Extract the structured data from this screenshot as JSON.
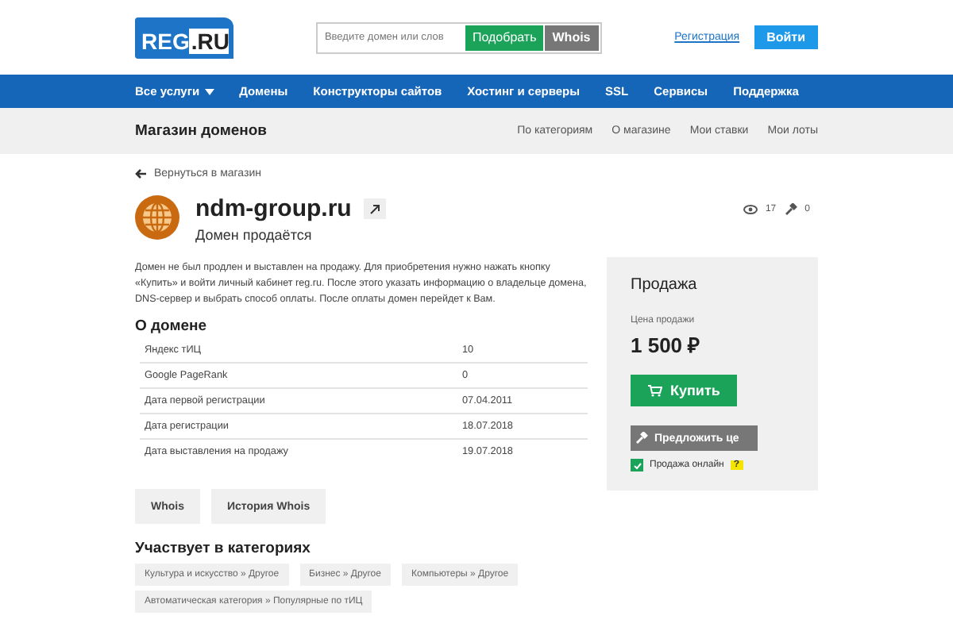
{
  "header": {
    "logo": "REG",
    "logo_suffix": ".RU",
    "search": {
      "placeholder": "Введите домен или слов"
    },
    "pick_button": "Подобрать",
    "whois_button": "Whois",
    "register_link": "Регистрация",
    "login_button": "Войти"
  },
  "nav": [
    {
      "label": "Все услуги",
      "dropdown": true
    },
    {
      "label": "Домены",
      "dropdown": false
    },
    {
      "label": "Конструкторы сайтов",
      "dropdown": false
    },
    {
      "label": "Хостинг и серверы",
      "dropdown": false
    },
    {
      "label": "SSL",
      "dropdown": false
    },
    {
      "label": "Сервисы",
      "dropdown": false
    },
    {
      "label": "Поддержка",
      "dropdown": false
    }
  ],
  "subbar": {
    "title": "Магазин доменов",
    "links": [
      "По категориям",
      "О магазине",
      "Мои ставки",
      "Мои лоты"
    ]
  },
  "back_link": "Вернуться в магазин",
  "domain": {
    "name": "ndm-group.ru",
    "status": "Домен продаётся",
    "views": "17",
    "bids": "0"
  },
  "description": "Домен не был продлен и выставлен на продажу. Для приобретения нужно нажать кнопку «Купить» и войти личный кабинет reg.ru. После этого указать информацию о владельце домена, DNS-сервер и выбрать способ оплаты. После оплаты домен перейдет к Вам.",
  "about": {
    "title": "О домене",
    "rows": [
      {
        "label": "Яндекс тИЦ",
        "value": "10"
      },
      {
        "label": "Google PageRank",
        "value": "0"
      },
      {
        "label": "Дата первой регистрации",
        "value": "07.04.2011"
      },
      {
        "label": "Дата регистрации",
        "value": "18.07.2018"
      },
      {
        "label": "Дата выставления на продажу",
        "value": "19.07.2018"
      }
    ]
  },
  "buttons": [
    "Whois",
    "История Whois"
  ],
  "categories": {
    "title": "Участвует в категориях",
    "tags": [
      "Культура и искусство » Другое",
      "Бизнес » Другое",
      "Компьютеры » Другое",
      "Автоматическая категория » Популярные по тИЦ"
    ]
  },
  "sale": {
    "title": "Продажа",
    "price_label": "Цена продажи",
    "price": "1 500 ₽",
    "buy_button": "Купить",
    "offer_button": "Предложить це",
    "online": {
      "label": "Продажа онлайн",
      "checked": true,
      "help": "?"
    }
  }
}
